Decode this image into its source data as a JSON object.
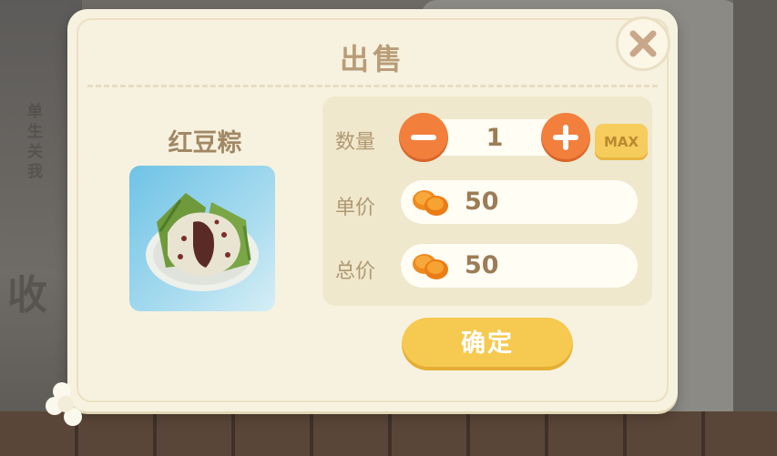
{
  "dialog": {
    "title": "出售",
    "close_icon": "x-icon"
  },
  "item": {
    "name": "红豆粽",
    "image": "red-bean-zongzi"
  },
  "form": {
    "quantity_label": "数量",
    "quantity_value": "1",
    "max_label": "MAX",
    "unit_price_label": "单价",
    "unit_price_value": "50",
    "total_price_label": "总价",
    "total_price_value": "50",
    "currency_icon": "orange-coin-icon"
  },
  "confirm_label": "确定",
  "background": {
    "left_vertical_text": "单生关我",
    "left_char": "收"
  },
  "colors": {
    "dialog_bg": "#f7f2df",
    "title": "#b99d78",
    "orange_button": "#f27f3b",
    "yellow_button": "#f6c950",
    "value_text": "#9c7c57"
  }
}
